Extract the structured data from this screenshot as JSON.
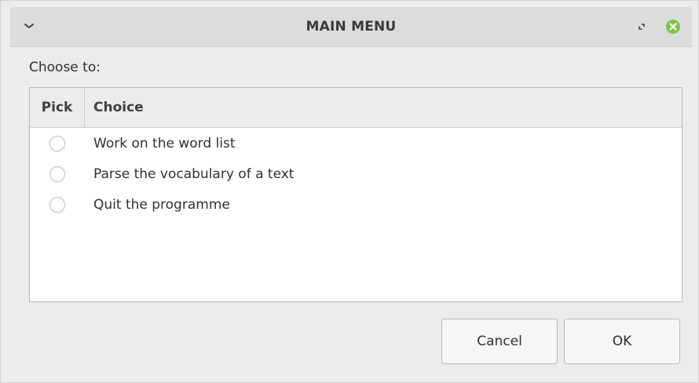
{
  "window": {
    "title": "MAIN MENU"
  },
  "icons": {
    "menu": "chevron-down-icon",
    "restore": "restore-icon",
    "close": "close-icon"
  },
  "colors": {
    "close_button": "#7ec24a"
  },
  "prompt": "Choose to:",
  "list": {
    "columns": [
      "Pick",
      "Choice"
    ],
    "rows": [
      {
        "selected": false,
        "label": "Work on the word list"
      },
      {
        "selected": false,
        "label": "Parse the vocabulary of a text"
      },
      {
        "selected": false,
        "label": "Quit the programme"
      }
    ]
  },
  "buttons": {
    "cancel_label": "Cancel",
    "ok_label": "OK"
  }
}
